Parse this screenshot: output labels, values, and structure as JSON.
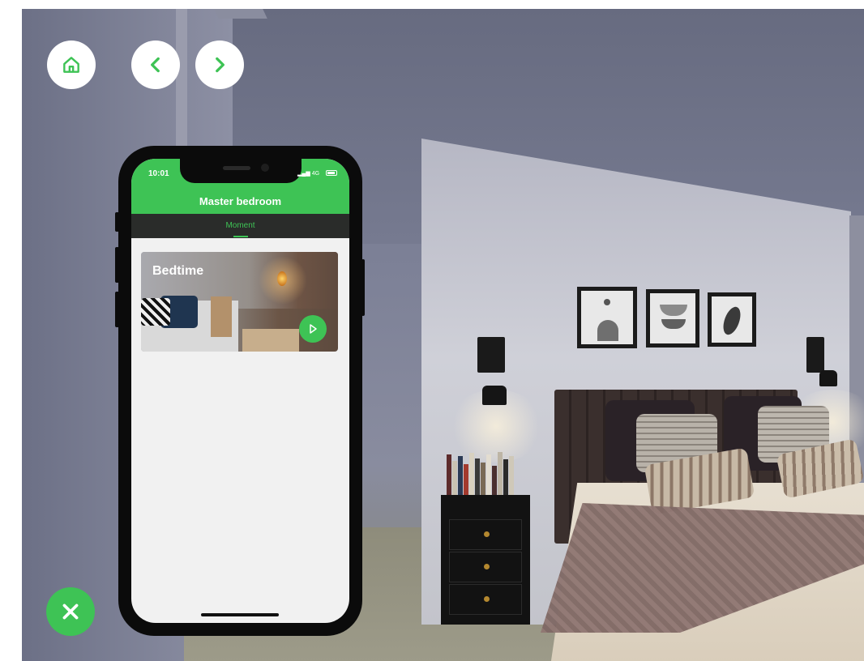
{
  "nav": {
    "home_icon": "home-icon",
    "back_icon": "chevron-left-icon",
    "forward_icon": "chevron-right-icon",
    "close_icon": "close-icon"
  },
  "phone": {
    "status_time": "10:01",
    "network": "4G",
    "room_title": "Master bedroom",
    "tabs": [
      {
        "label": "Moment",
        "active": true
      }
    ],
    "moments": [
      {
        "title": "Bedtime",
        "action_icon": "play-icon"
      }
    ]
  },
  "colors": {
    "accent": "#3ec355",
    "tab_bar": "#2a2c2a",
    "screen_bg": "#f1f1f1"
  }
}
